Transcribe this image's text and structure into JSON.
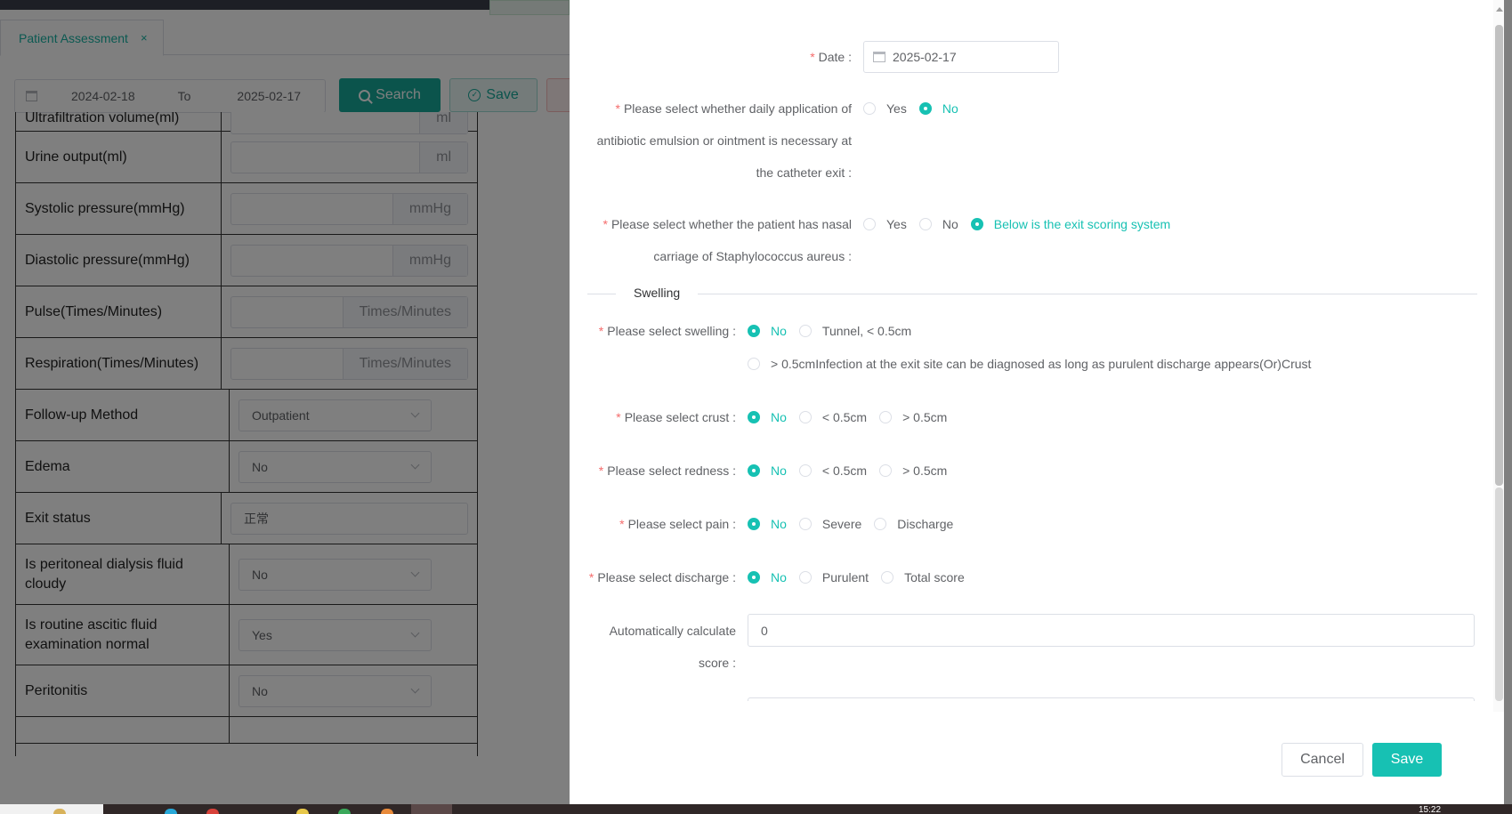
{
  "background": {
    "tab": {
      "label": "Patient Assessment",
      "close": "×"
    },
    "filter": {
      "date_from": "2024-02-18",
      "to_label": "To",
      "date_to": "2025-02-17"
    },
    "buttons": {
      "search": "Search",
      "save": "Save"
    },
    "rows": [
      {
        "label": "Ultrafiltration volume(ml)",
        "type": "unit",
        "unit": "ml"
      },
      {
        "label": "Urine output(ml)",
        "type": "unit",
        "unit": "ml"
      },
      {
        "label": "Systolic pressure(mmHg)",
        "type": "unit",
        "unit": "mmHg"
      },
      {
        "label": "Diastolic pressure(mmHg)",
        "type": "unit",
        "unit": "mmHg"
      },
      {
        "label": "Pulse(Times/Minutes)",
        "type": "unit",
        "unit": "Times/Minutes"
      },
      {
        "label": "Respiration(Times/Minutes)",
        "type": "unit",
        "unit": "Times/Minutes"
      },
      {
        "label": "Follow-up Method",
        "type": "select",
        "value": "Outpatient"
      },
      {
        "label": "Edema",
        "type": "select",
        "value": "No"
      },
      {
        "label": "Exit status",
        "type": "text",
        "value": "正常"
      },
      {
        "label": "Is peritoneal dialysis fluid cloudy",
        "type": "select",
        "value": "No"
      },
      {
        "label": "Is routine ascitic fluid examination normal",
        "type": "select",
        "value": "Yes"
      },
      {
        "label": "Peritonitis",
        "type": "select",
        "value": "No"
      }
    ]
  },
  "drawer": {
    "date": {
      "label": "Date :",
      "value": "2025-02-17"
    },
    "antibiotic": {
      "label_line1": "Please select whether daily application of",
      "label_line2": "antibiotic emulsion or ointment is necessary at",
      "label_line3": "the catheter exit :",
      "options": [
        "Yes",
        "No"
      ],
      "selected": 1
    },
    "nasal": {
      "label_line1": "Please select whether the patient has nasal",
      "label_line2": "carriage of Staphylococcus aureus :",
      "options": [
        "Yes",
        "No",
        "Below is the exit scoring system"
      ],
      "selected": 2
    },
    "section_title": "Swelling",
    "swelling": {
      "label": "Please select swelling :",
      "options": [
        "No",
        "Tunnel, < 0.5cm"
      ],
      "option_line2": "> 0.5cmInfection at the exit site can be diagnosed as long as purulent discharge appears(Or)Crust",
      "selected": 0
    },
    "crust": {
      "label": "Please select crust :",
      "options": [
        "No",
        "< 0.5cm",
        "> 0.5cm"
      ],
      "selected": 0
    },
    "redness": {
      "label": "Please select redness :",
      "options": [
        "No",
        "< 0.5cm",
        "> 0.5cm"
      ],
      "selected": 0
    },
    "pain": {
      "label": "Please select pain :",
      "options": [
        "No",
        "Severe",
        "Discharge"
      ],
      "selected": 0
    },
    "discharge": {
      "label": "Please select discharge :",
      "options": [
        "No",
        "Purulent",
        "Total score"
      ],
      "selected": 0
    },
    "score": {
      "label_line1": "Automatically calculate",
      "label_line2": "score :",
      "value": "0"
    },
    "buttons": {
      "cancel": "Cancel",
      "save": "Save"
    }
  },
  "taskbar": {
    "clock": "15:22"
  },
  "colors": {
    "accent": "#17c1b3",
    "required": "#f56c6c",
    "overlay": "rgba(0,0,0,0.5)"
  }
}
